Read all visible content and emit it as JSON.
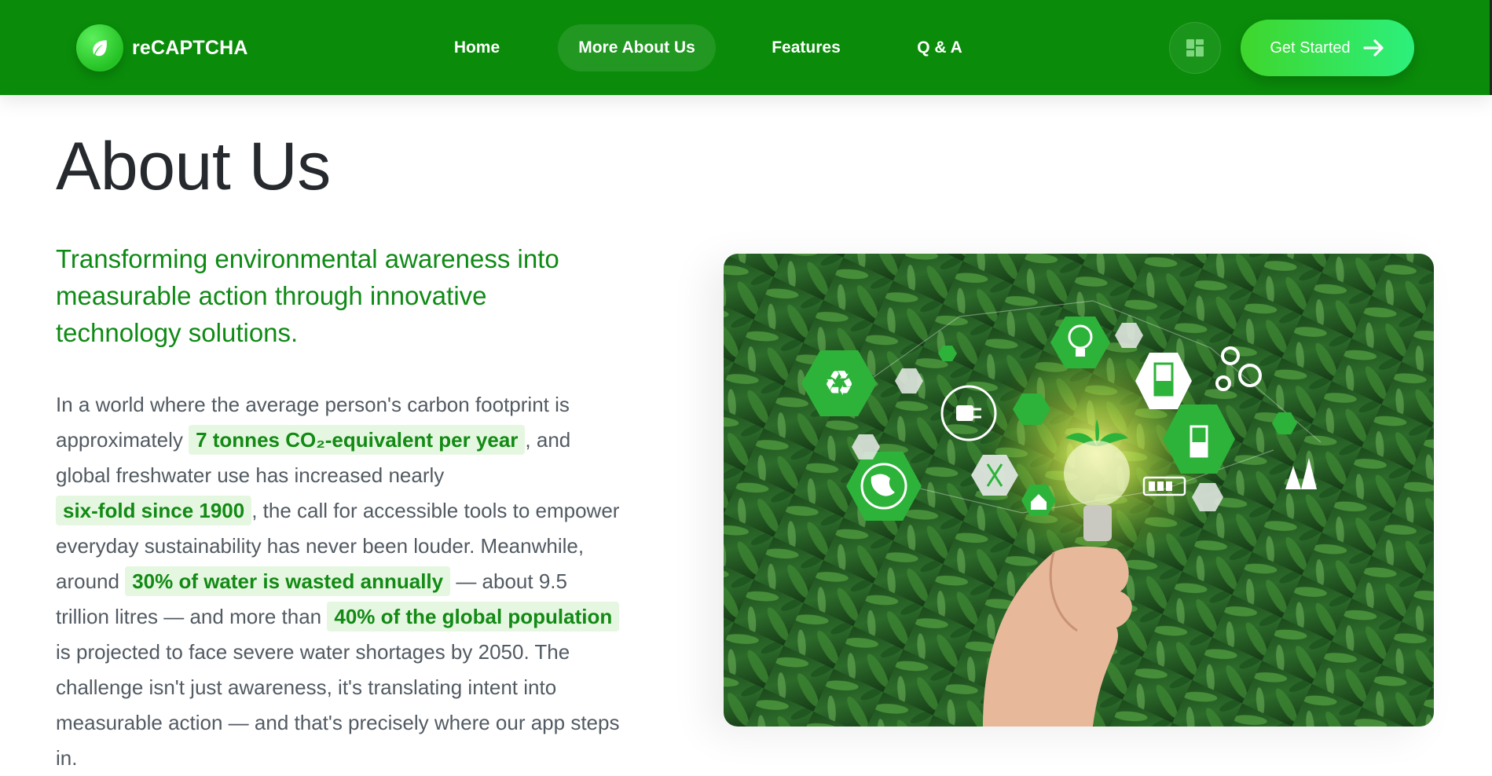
{
  "header": {
    "brand_name": "reCAPTCHA",
    "brand_icon": "leaf-icon",
    "nav": [
      {
        "label": "Home",
        "active": false
      },
      {
        "label": "More About Us",
        "active": true
      },
      {
        "label": "Features",
        "active": false
      },
      {
        "label": "Q & A",
        "active": false
      }
    ],
    "dashboard_icon": "dashboard-icon",
    "cta_label": "Get Started",
    "cta_icon": "arrow-right-icon"
  },
  "main": {
    "title": "About Us",
    "lead": "Transforming environmental awareness into measurable action through innovative technology solutions.",
    "body": {
      "t1": "In a world where the average person's carbon footprint is approximately ",
      "h1": "7 tonnes CO₂-equivalent per year",
      "t2": ", and global freshwater use has increased nearly ",
      "h2": "six-fold since 1900",
      "t3": ", the call for accessible tools to empower everyday sustainability has never been louder. Meanwhile, around ",
      "h3": "30% of water is wasted annually",
      "t4": " — about 9.5 trillion litres — and more than ",
      "h4": "40% of the global population",
      "t5": " is projected to face severe water shortages by 2050. The challenge isn't just awareness, it's translating intent into measurable action — and that's precisely where our app steps in."
    },
    "hero_image": {
      "icons": [
        "recycle-icon",
        "plug-icon",
        "lightbulb-icon",
        "beaker-icon",
        "gears-icon",
        "globe-icon",
        "dna-icon",
        "eco-house-icon",
        "battery-icon",
        "trees-icon",
        "leaf-sprout-icon"
      ]
    }
  },
  "colors": {
    "header_bg": "#0a8c0a",
    "accent_green": "#0f8a15",
    "highlight_bg": "#e6f7e1",
    "cta_start": "#3fd62c",
    "cta_end": "#2cf07c",
    "body_text": "#525a62",
    "title_text": "#262a2e"
  }
}
